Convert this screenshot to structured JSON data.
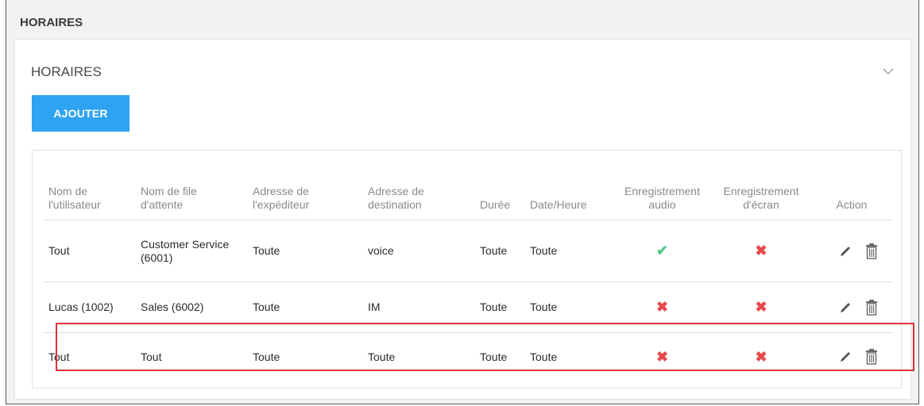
{
  "section_title": "HORAIRES",
  "panel": {
    "title": "HORAIRES",
    "add_label": "AJOUTER"
  },
  "columns": {
    "user": "Nom de\nl'utilisateur",
    "queue": "Nom de file\nd'attente",
    "sender": "Adresse de\nl'expéditeur",
    "dest": "Adresse de\ndestination",
    "duration": "Durée",
    "datetime": "Date/Heure",
    "audio": "Enregistrement\naudio",
    "screen": "Enregistrement\nd'écran",
    "action": "Action"
  },
  "rows": [
    {
      "user": "Tout",
      "queue": "Customer Service (6001)",
      "sender": "Toute",
      "dest": "voice",
      "duration": "Toute",
      "datetime": "Toute",
      "audio": true,
      "screen": false
    },
    {
      "user": "Lucas (1002)",
      "queue": "Sales (6002)",
      "sender": "Toute",
      "dest": "IM",
      "duration": "Toute",
      "datetime": "Toute",
      "audio": false,
      "screen": false
    },
    {
      "user": "Tout",
      "queue": "Tout",
      "sender": "Toute",
      "dest": "Toute",
      "duration": "Toute",
      "datetime": "Toute",
      "audio": false,
      "screen": false
    }
  ],
  "highlighted_row": 3,
  "icons": {
    "yes": "check-icon",
    "no": "cross-icon",
    "edit": "pencil-icon",
    "delete": "trash-icon",
    "collapse": "chevron-down-icon"
  },
  "colors": {
    "accent": "#2ea3f2",
    "yes": "#58c68c",
    "no": "#e8494d",
    "highlight": "#e0333a"
  }
}
